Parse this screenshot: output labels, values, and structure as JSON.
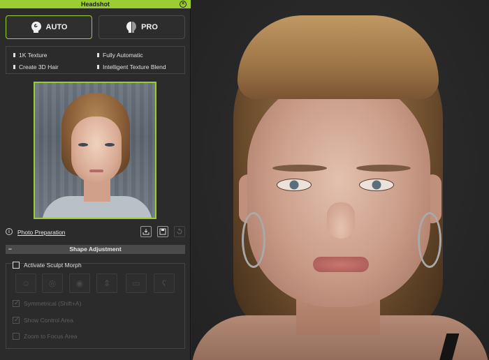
{
  "window": {
    "title": "Headshot",
    "close_icon": "close-circle-icon"
  },
  "modes": {
    "auto": {
      "label": "AUTO",
      "icon": "head-swirl-icon",
      "selected": true
    },
    "pro": {
      "label": "PRO",
      "icon": "head-split-icon",
      "selected": false
    }
  },
  "features": [
    "1K Texture",
    "Fully Automatic",
    "Create 3D Hair",
    "Intelligent Texture Blend"
  ],
  "photo": {
    "alt_icon": "source-photo"
  },
  "photo_preparation": {
    "label": "Photo Preparation",
    "info_icon": "info-icon"
  },
  "toolbar": {
    "load_icon": "load-photo-icon",
    "save_icon": "save-icon",
    "reset_icon": "reset-icon"
  },
  "shape_adjustment": {
    "header": "Shape Adjustment",
    "collapse_symbol": "−",
    "activate_sculpt_morph": {
      "label": "Activate Sculpt Morph",
      "checked": false
    },
    "morph_tools": [
      "face-tool-icon",
      "head-tool-icon",
      "eye-tool-icon",
      "nose-tool-icon",
      "mouth-tool-icon",
      "ear-tool-icon"
    ],
    "symmetrical": {
      "label": "Symmetrical (Shift+A)",
      "checked": true,
      "enabled": false
    },
    "show_control_area": {
      "label": "Show Control Area",
      "checked": true,
      "enabled": false
    },
    "zoom_to_focus": {
      "label": "Zoom to Focus Area",
      "checked": false,
      "enabled": false
    }
  },
  "colors": {
    "accent": "#9acd32",
    "panel_bg": "#2b2b2b",
    "viewport_bg": "#2a2a2a"
  }
}
